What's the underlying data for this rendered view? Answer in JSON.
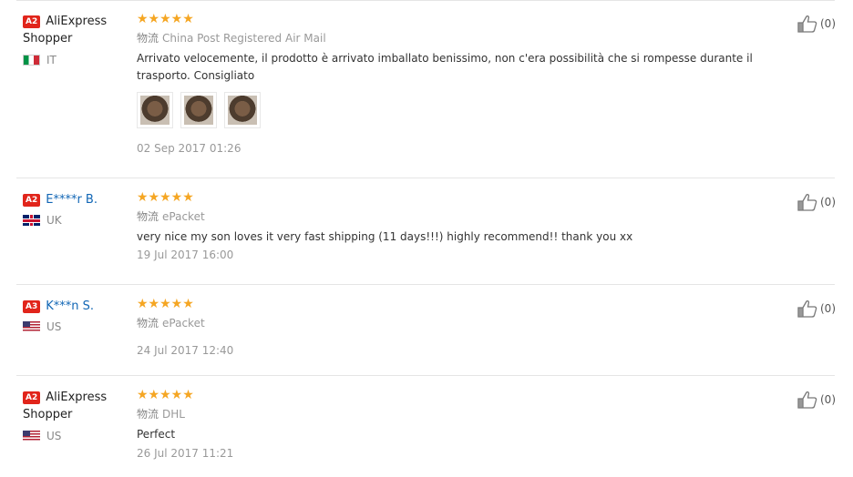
{
  "reviews": [
    {
      "level": "A2",
      "name": "AliExpress Shopper",
      "name_color": "dark",
      "country": "IT",
      "flag": "it",
      "stars": "★★★★★",
      "logistics_cn": "物流",
      "logistics": "China Post Registered Air Mail",
      "text": "Arrivato velocemente, il prodotto è arrivato imballato benissimo, non c'era possibilità che si rompesse durante il trasporto. Consigliato",
      "photos": 3,
      "date": "02 Sep 2017 01:26",
      "likes": "(0)"
    },
    {
      "level": "A2",
      "name": "E****r B.",
      "name_color": "blue",
      "country": "UK",
      "flag": "uk",
      "stars": "★★★★★",
      "logistics_cn": "物流",
      "logistics": "ePacket",
      "text": "very nice my son loves it very fast shipping (11 days!!!) highly recommend!! thank you xx",
      "photos": 0,
      "date": "19 Jul 2017 16:00",
      "likes": "(0)"
    },
    {
      "level": "A3",
      "name": "K***n S.",
      "name_color": "blue",
      "country": "US",
      "flag": "us",
      "stars": "★★★★★",
      "logistics_cn": "物流",
      "logistics": "ePacket",
      "text": "",
      "photos": 0,
      "date": "24 Jul 2017 12:40",
      "likes": "(0)"
    },
    {
      "level": "A2",
      "name": "AliExpress Shopper",
      "name_color": "dark",
      "country": "US",
      "flag": "us",
      "stars": "★★★★★",
      "logistics_cn": "物流",
      "logistics": "DHL",
      "text": "Perfect",
      "photos": 0,
      "date": "26 Jul 2017 11:21",
      "likes": "(0)"
    }
  ]
}
